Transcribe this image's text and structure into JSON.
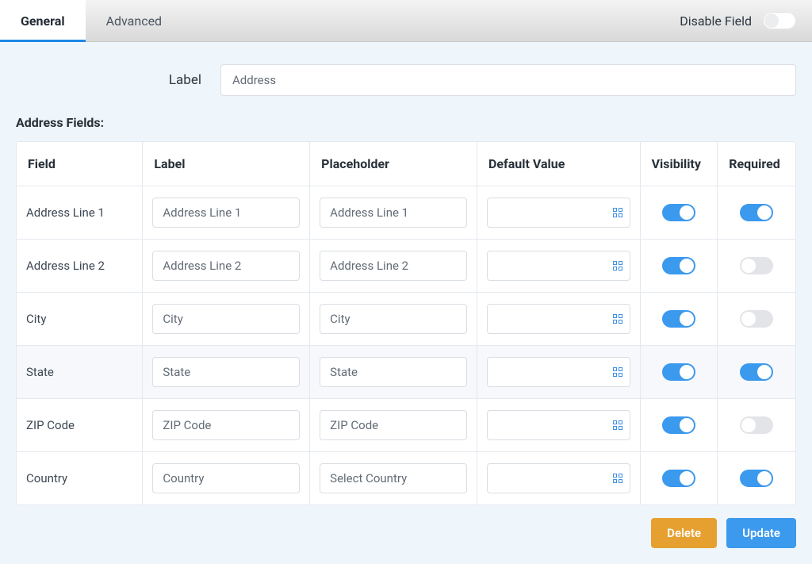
{
  "tabs": {
    "general": "General",
    "advanced": "Advanced"
  },
  "disable_field_label": "Disable Field",
  "disable_field_on": false,
  "label_field": {
    "label": "Label",
    "value": "Address"
  },
  "section_title": "Address Fields:",
  "columns": {
    "field": "Field",
    "label": "Label",
    "placeholder": "Placeholder",
    "default": "Default Value",
    "visibility": "Visibility",
    "required": "Required"
  },
  "rows": [
    {
      "field": "Address Line 1",
      "label": "Address Line 1",
      "placeholder": "Address Line 1",
      "default": "",
      "visibility": true,
      "required": true
    },
    {
      "field": "Address Line 2",
      "label": "Address Line 2",
      "placeholder": "Address Line 2",
      "default": "",
      "visibility": true,
      "required": false
    },
    {
      "field": "City",
      "label": "City",
      "placeholder": "City",
      "default": "",
      "visibility": true,
      "required": false
    },
    {
      "field": "State",
      "label": "State",
      "placeholder": "State",
      "default": "",
      "visibility": true,
      "required": true
    },
    {
      "field": "ZIP Code",
      "label": "ZIP Code",
      "placeholder": "ZIP Code",
      "default": "",
      "visibility": true,
      "required": false
    },
    {
      "field": "Country",
      "label": "Country",
      "placeholder": "Select Country",
      "default": "",
      "visibility": true,
      "required": true
    }
  ],
  "buttons": {
    "delete": "Delete",
    "update": "Update"
  }
}
